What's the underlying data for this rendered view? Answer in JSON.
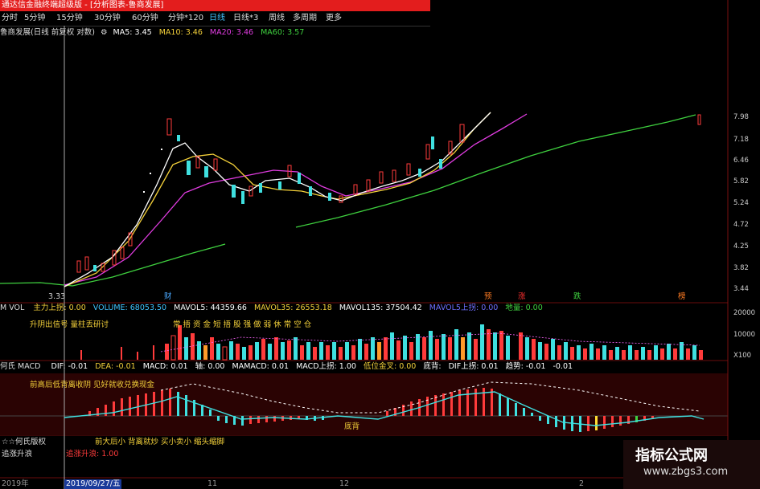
{
  "title_bar": "通达信金融终端超级版 - [分析图表-鲁商发展]",
  "period_tabs": [
    {
      "label": "分时",
      "active": false
    },
    {
      "label": "5分钟",
      "active": false
    },
    {
      "label": "15分钟",
      "active": false
    },
    {
      "label": "30分钟",
      "active": false
    },
    {
      "label": "60分钟",
      "active": false
    },
    {
      "label": "分钟*120",
      "active": false
    },
    {
      "label": "日线",
      "active": true
    },
    {
      "label": "日线*3",
      "active": false
    },
    {
      "label": "周线",
      "active": false
    },
    {
      "label": "多周期",
      "active": false
    },
    {
      "label": "更多",
      "active": false
    }
  ],
  "main_chart": {
    "stock_label": "鲁商发展(日线 前复权 对数)",
    "ma_items": [
      {
        "label": "MA5: 3.45",
        "color": "#ffffff"
      },
      {
        "label": "MA10: 3.46",
        "color": "#f4d13a"
      },
      {
        "label": "MA20: 3.46",
        "color": "#e03ce0"
      },
      {
        "label": "MA60: 3.57",
        "color": "#3fd13f"
      }
    ],
    "low_label": "3.33",
    "price_ticks": [
      "7.98",
      "7.18",
      "6.46",
      "5.82",
      "5.24",
      "4.72",
      "4.25",
      "3.82",
      "3.44"
    ],
    "event_markers": [
      {
        "label": "财",
        "color": "#4aa8ff"
      },
      {
        "label": "预",
        "color": "#ff7b22"
      },
      {
        "label": "涨",
        "color": "#ff3030"
      },
      {
        "label": "跌",
        "color": "#3fd13f"
      },
      {
        "label": "榜",
        "color": "#ff7b22"
      }
    ]
  },
  "volume_panel": {
    "items": [
      {
        "label": "M VOL",
        "color": "#dddddd"
      },
      {
        "label": "主力上拐: 0.00",
        "color": "#f4d13a"
      },
      {
        "label": "VOLUME: 68053.50",
        "color": "#41c4ff"
      },
      {
        "label": "MAVOL5: 44359.66",
        "color": "#ffffff"
      },
      {
        "label": "MAVOL35: 26553.18",
        "color": "#f4d13a"
      },
      {
        "label": "MAVOL135: 37504.42",
        "color": "#ffffff"
      },
      {
        "label": "MAVOL5上拐: 0.00",
        "color": "#6f6fff"
      },
      {
        "label": "地量: 0.00",
        "color": "#3fd13f"
      }
    ],
    "note1": "升阴出信号 量柱丢研讨",
    "note2": "常 捂 资 金 短 捂 股 强 做 弱 休 常 空 仓",
    "ticks": [
      "20000",
      "10000",
      "X100"
    ]
  },
  "macd_panel": {
    "items": [
      {
        "label": "何氏 MACD",
        "color": "#dddddd"
      },
      {
        "label": "DIF: -0.01",
        "color": "#ffffff"
      },
      {
        "label": "DEA: -0.01",
        "color": "#f4d13a"
      },
      {
        "label": "MACD: 0.01",
        "color": "#ffffff"
      },
      {
        "label": "轴: 0.00",
        "color": "#ffffff"
      },
      {
        "label": "MAMACD: 0.01",
        "color": "#ffffff"
      },
      {
        "label": "MACD上拐: 1.00",
        "color": "#ffffff"
      },
      {
        "label": "低位金叉: 0.00",
        "color": "#f4d13a"
      },
      {
        "label": "底背: ",
        "color": "#ffffff"
      },
      {
        "label": "DIF上拐: 0.01",
        "color": "#ffffff"
      },
      {
        "label": "趋势: -0.01",
        "color": "#ffffff"
      },
      {
        "label": "-0.01",
        "color": "#ffffff"
      }
    ],
    "note1": "前高后低背离收阴  见好就收兑换现金",
    "bottom_label": "底背"
  },
  "bottom_panel": {
    "label1": "☆☆何氏版权",
    "notes": "前大后小   背离就炒      买小卖小    缩头缩脚",
    "label2": "追涨升浪",
    "label3": "追涨升浪: 1.00"
  },
  "date_axis": {
    "year": "2019年",
    "cursor_date": "2019/09/27/五",
    "marks": [
      "11",
      "12",
      "2"
    ]
  },
  "watermark": {
    "cn": "指标公式网",
    "url": "www.zbgs3.com"
  }
}
